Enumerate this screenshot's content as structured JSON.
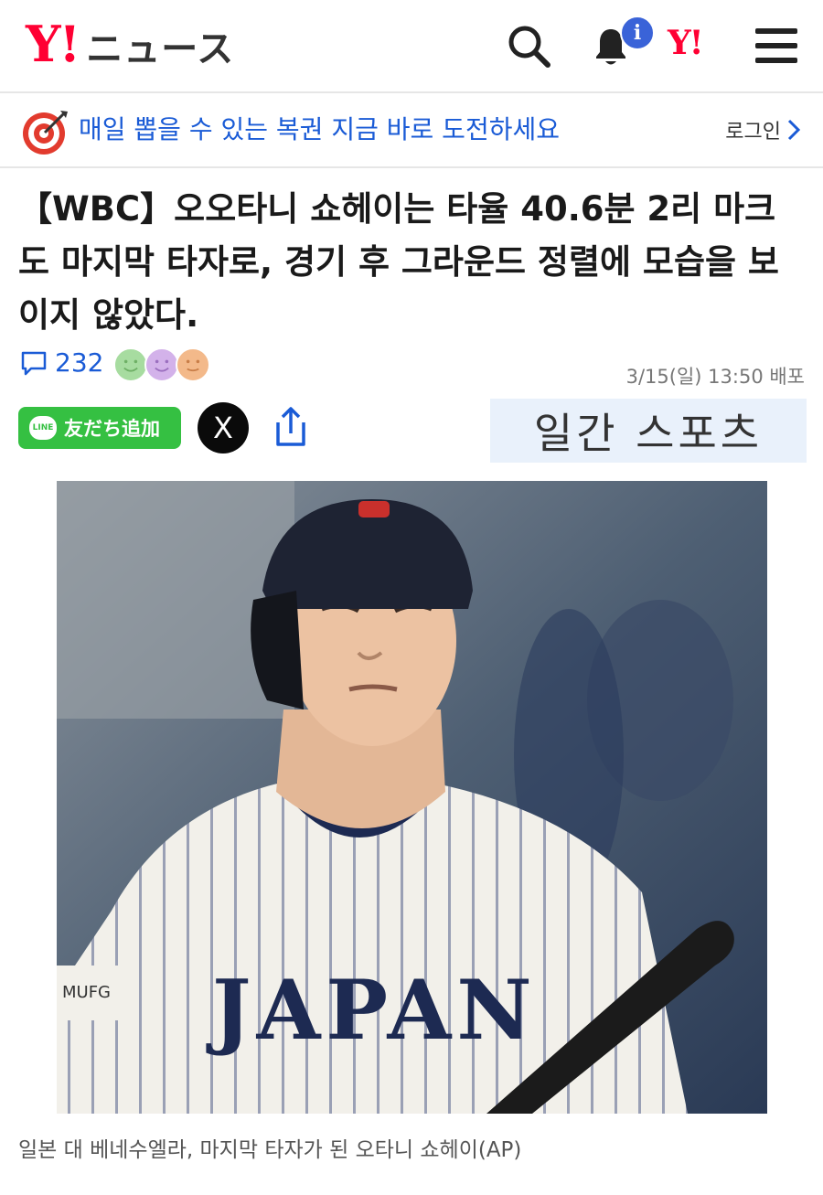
{
  "header": {
    "logo_mark": "Y!",
    "logo_text": "ニュース",
    "notification_badge": "i",
    "yahoo_mark": "Y!"
  },
  "promo": {
    "text": "매일 뽑을 수 있는 복권 지금 바로 도전하세요",
    "login_label": "로그인"
  },
  "article": {
    "title": "【WBC】오오타니 쇼헤이는 타율 40.6분 2리 마크도 마지막 타자로, 경기 후 그라운드 정렬에 모습을 보이지 않았다.",
    "comment_count": "232",
    "published": "3/15(일) 13:50 배포",
    "source": "일간 스포츠",
    "caption": "일본 대 베네수엘라, 마지막 타자가 된 오타니 쇼헤이(AP)"
  },
  "share": {
    "line_logo": "LINE",
    "line_label": "友だち追加",
    "x_label": "X"
  },
  "photo": {
    "jersey_text": "JAPAN",
    "patch_text": "MUFG"
  },
  "colors": {
    "brand_red": "#ff0033",
    "link_blue": "#1a5bd6",
    "line_green": "#35c042"
  }
}
